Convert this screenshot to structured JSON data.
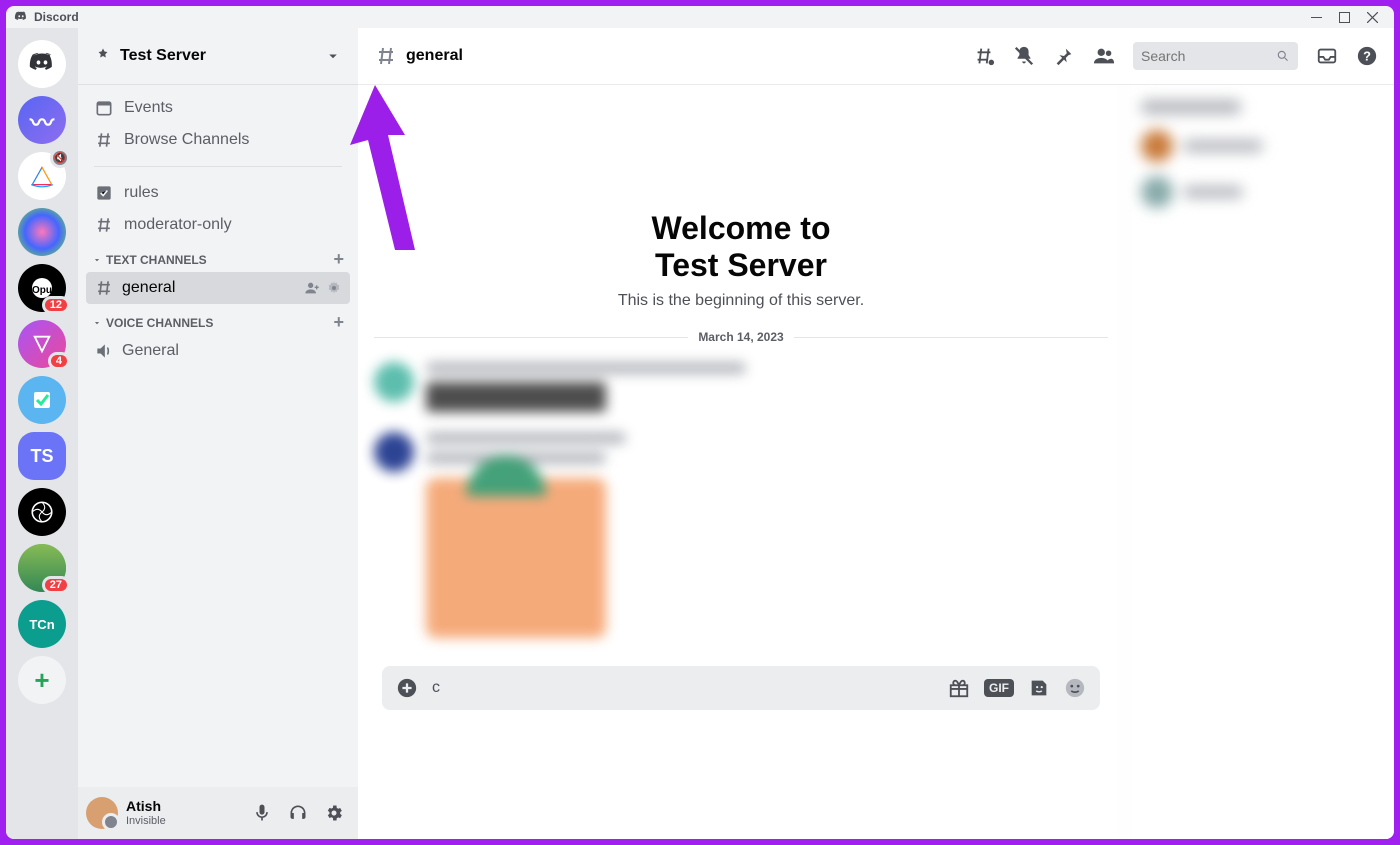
{
  "window": {
    "title": "Discord"
  },
  "serverHeader": {
    "name": "Test Server"
  },
  "sidebar": {
    "events": "Events",
    "browse": "Browse Channels",
    "rules": "rules",
    "mod": "moderator-only",
    "textCat": "Text Channels",
    "general": "general",
    "voiceCat": "Voice Channels",
    "voiceGeneral": "General"
  },
  "serverRail": {
    "ts": "TS",
    "badges": {
      "b1": "12",
      "b2": "4",
      "b3": "27"
    }
  },
  "user": {
    "name": "Atish",
    "status": "Invisible"
  },
  "channelHeader": {
    "name": "general",
    "searchPlaceholder": "Search"
  },
  "welcome": {
    "line1": "Welcome to",
    "line2": "Test Server",
    "sub": "This is the beginning of this server.",
    "date": "March 14, 2023"
  },
  "composer": {
    "text": "c"
  }
}
